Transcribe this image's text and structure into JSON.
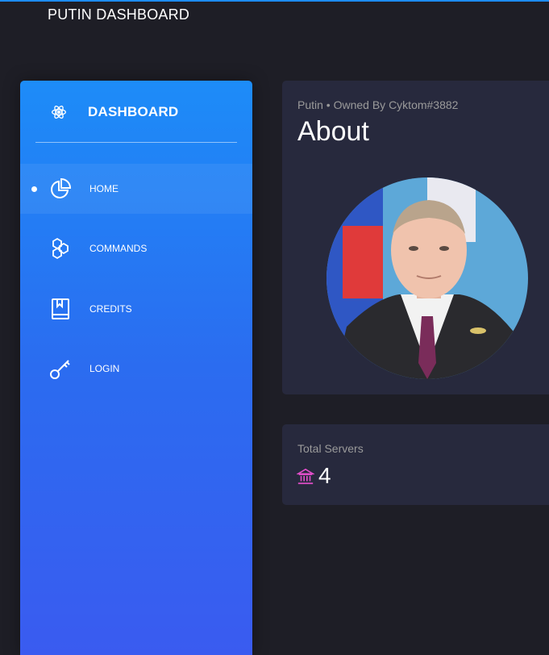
{
  "app": {
    "brand": "PUTIN DASHBOARD"
  },
  "sidebar": {
    "title": "DASHBOARD",
    "items": [
      {
        "label": "HOME",
        "icon": "pie-chart-icon",
        "active": true
      },
      {
        "label": "COMMANDS",
        "icon": "hexagons-icon",
        "active": false
      },
      {
        "label": "CREDITS",
        "icon": "book-icon",
        "active": false
      },
      {
        "label": "LOGIN",
        "icon": "key-icon",
        "active": false
      }
    ]
  },
  "about": {
    "subtitle": "Putin • Owned By Cyktom#3882",
    "title": "About",
    "avatar_icon": "bot-avatar"
  },
  "stats": {
    "servers_label": "Total Servers",
    "servers_value": "4",
    "servers_icon": "bank-icon"
  },
  "colors": {
    "accent": "#1d8cf8",
    "bank_icon": "#e14eca",
    "card": "#27293d",
    "background": "#1e1e26"
  }
}
